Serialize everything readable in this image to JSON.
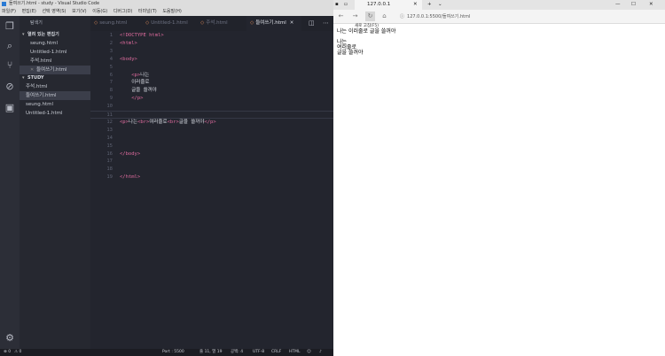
{
  "vscode": {
    "title": "들여쓰기.html - study - Visual Studio Code",
    "menu": [
      "파일(F)",
      "편집(E)",
      "선택 영역(S)",
      "보기(V)",
      "이동(G)",
      "디버그(D)",
      "터미널(T)",
      "도움말(H)"
    ],
    "activity_icons": [
      "files-icon",
      "search-icon",
      "source-control-icon",
      "debug-icon",
      "extensions-icon"
    ],
    "sidebar": {
      "header": "탐색기",
      "open_editors_title": "열려 있는 편집기",
      "open_editors": [
        "seung.html",
        "Untitled-1.html",
        "주석.html",
        "들여쓰기.html"
      ],
      "study_title": "STUDY",
      "study_files": [
        "주석.html",
        "들여쓰기.html",
        "seung.html",
        "Untitled-1.html"
      ]
    },
    "tabs": [
      "seung.html",
      "Untitled-1.html",
      "주석.html",
      "들여쓰기.html"
    ],
    "code_lines": [
      {
        "n": "1",
        "t": "<!DOCTYPE html>"
      },
      {
        "n": "2",
        "t": "<html>"
      },
      {
        "n": "3",
        "t": ""
      },
      {
        "n": "4",
        "t": "<body>"
      },
      {
        "n": "5",
        "t": ""
      },
      {
        "n": "6",
        "t": "    <p>나는"
      },
      {
        "n": "7",
        "t": "    이러줄로"
      },
      {
        "n": "8",
        "t": "    글을 쓸꺼야"
      },
      {
        "n": "9",
        "t": "    </p>"
      },
      {
        "n": "10",
        "t": ""
      },
      {
        "n": "11",
        "t": ""
      },
      {
        "n": "12",
        "t": "<p>나는<br>여러줄로<br>글을 쓸꺼야</p>"
      },
      {
        "n": "13",
        "t": ""
      },
      {
        "n": "14",
        "t": ""
      },
      {
        "n": "15",
        "t": ""
      },
      {
        "n": "16",
        "t": "</body>"
      },
      {
        "n": "17",
        "t": ""
      },
      {
        "n": "18",
        "t": ""
      },
      {
        "n": "19",
        "t": "</html>"
      }
    ],
    "status": {
      "errors": "⊗ 0",
      "warnings": "⚠ 0",
      "port": "Port : 5500",
      "position": "줄 11, 열 19",
      "spaces": "공백: 4",
      "encoding": "UTF-8",
      "eol": "CRLF",
      "language": "HTML"
    }
  },
  "browser": {
    "tab_title": "127.0.0.1",
    "new_tab": "+",
    "url": "127.0.0.1:5500/들여쓰기.html",
    "tooltip": "새로 고침(F5)",
    "page_lines_1": "나는 이러줄로 글을 쓸꺼야",
    "page_lines_2": [
      "나는",
      "여러줄로",
      "글을 쓸꺼야"
    ]
  }
}
